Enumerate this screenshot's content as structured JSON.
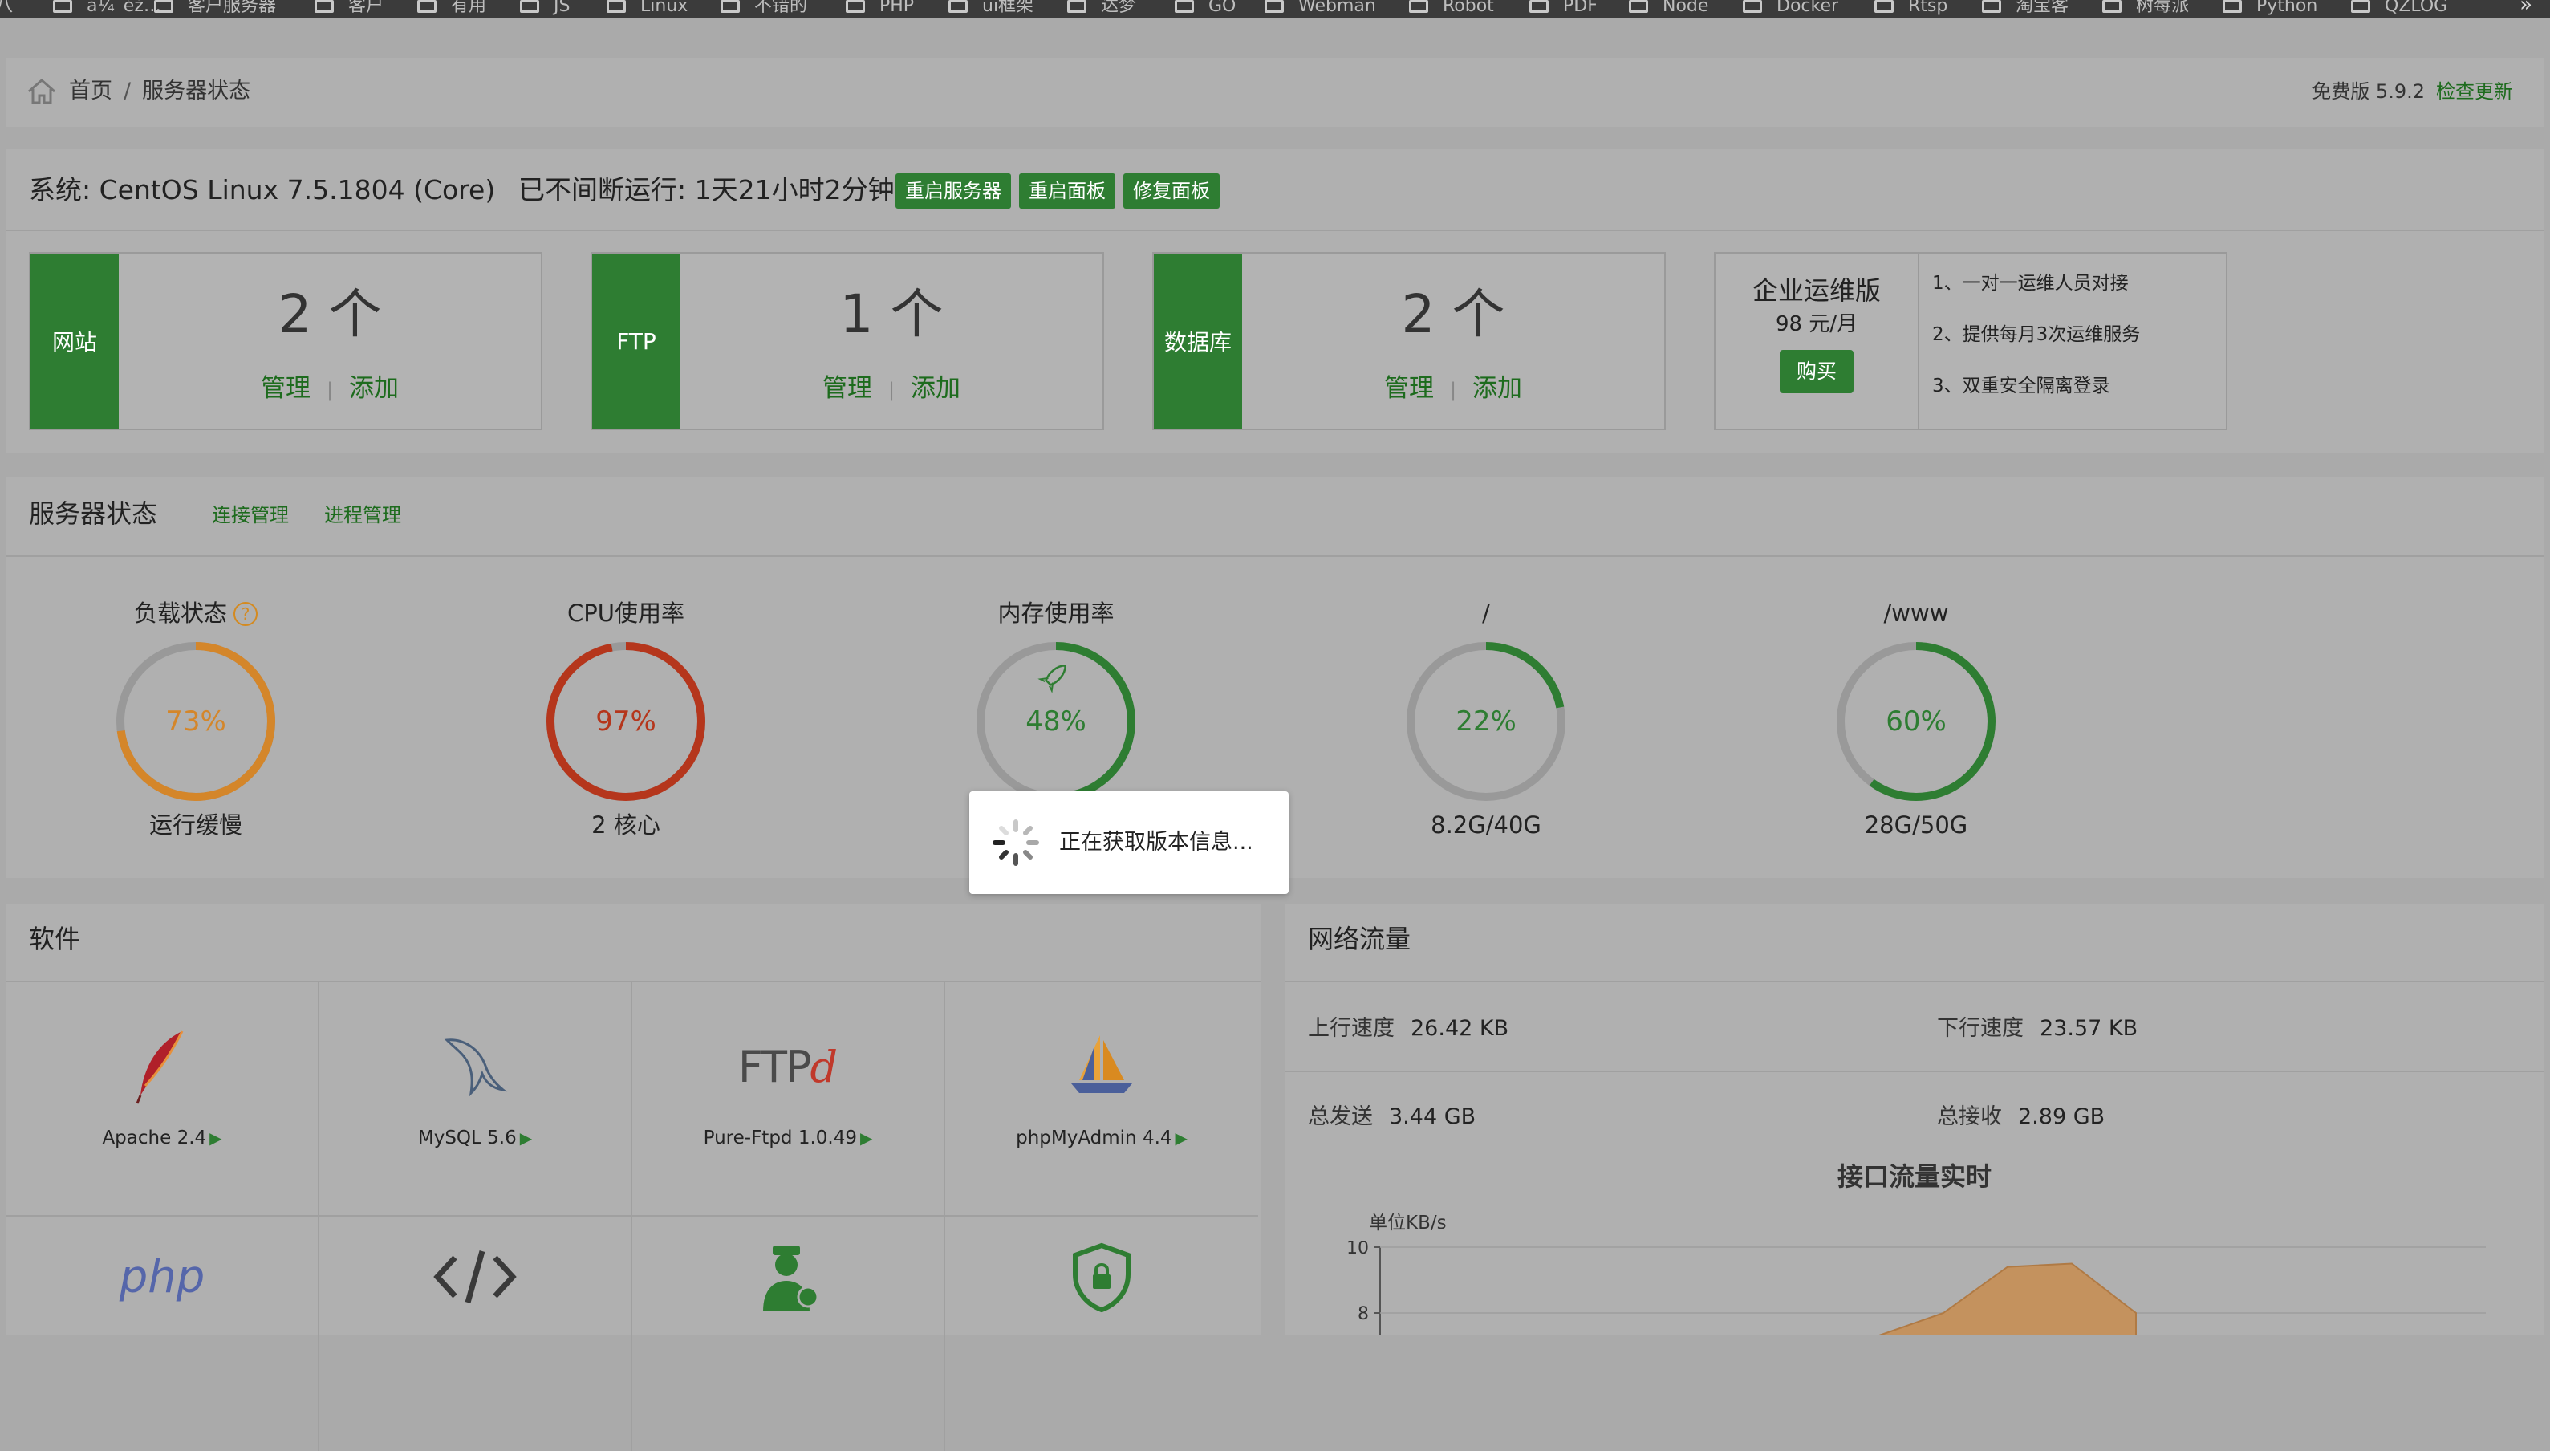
{
  "bookmarks": {
    "items": [
      "ä¼˜éž…",
      "客户服务器",
      "客户",
      "有用",
      "JS",
      "Linux",
      "不错的",
      "PHP",
      "ui框架",
      "达梦",
      "GO",
      "Webman",
      "Robot",
      "PDF",
      "Node",
      "Docker",
      "Rtsp",
      "淘宝客",
      "树莓派",
      "Python",
      "QZLOG"
    ],
    "more": "»"
  },
  "breadcrumb": {
    "home": "首页",
    "separator": "/",
    "current": "服务器状态",
    "version": "免费版 5.9.2",
    "update": "检查更新"
  },
  "system": {
    "name": "系统: CentOS Linux 7.5.1804 (Core)",
    "uptime": "已不间断运行: 1天21小时2分钟",
    "buttons": [
      "重启服务器",
      "重启面板",
      "修复面板"
    ]
  },
  "cards": [
    {
      "tag": "网站",
      "count": "2 个",
      "manage": "管理",
      "add": "添加"
    },
    {
      "tag": "FTP",
      "count": "1 个",
      "manage": "管理",
      "add": "添加"
    },
    {
      "tag": "数据库",
      "count": "2 个",
      "manage": "管理",
      "add": "添加"
    }
  ],
  "enterprise": {
    "name": "企业运维版",
    "price": "98 元/月",
    "buy": "购买",
    "features": [
      "1、一对一运维人员对接",
      "2、提供每月3次运维服务",
      "3、双重安全隔离登录"
    ]
  },
  "status": {
    "title": "服务器状态",
    "links": [
      "连接管理",
      "进程管理"
    ],
    "help": "?",
    "gauges": [
      {
        "title": "负载状态",
        "value": "73%",
        "percent": 73,
        "sub": "运行缓慢",
        "color": "#d4862a"
      },
      {
        "title": "CPU使用率",
        "value": "97%",
        "percent": 97,
        "sub": "2 核心",
        "color": "#b5361c"
      },
      {
        "title": "内存使用率",
        "value": "48%",
        "percent": 48,
        "sub": "",
        "color": "#2e7d32"
      },
      {
        "title": "/",
        "value": "22%",
        "percent": 22,
        "sub": "8.2G/40G",
        "color": "#2e7d32"
      },
      {
        "title": "/www",
        "value": "60%",
        "percent": 60,
        "sub": "28G/50G",
        "color": "#2e7d32"
      }
    ]
  },
  "toast": {
    "text": "正在获取版本信息..."
  },
  "software": {
    "title": "软件",
    "items": [
      {
        "label": "Apache 2.4",
        "icon": "apache-feather-icon"
      },
      {
        "label": "MySQL 5.6",
        "icon": "mysql-dolphin-icon"
      },
      {
        "label": "Pure-Ftpd 1.0.49",
        "icon": "ftpd-logo-icon"
      },
      {
        "label": "phpMyAdmin 4.4",
        "icon": "phpmyadmin-sailboat-icon"
      },
      {
        "label": "",
        "icon": "php-logo-icon"
      },
      {
        "label": "",
        "icon": "code-brackets-icon"
      },
      {
        "label": "",
        "icon": "worker-icon"
      },
      {
        "label": "",
        "icon": "shield-lock-icon"
      }
    ],
    "php_text": "php",
    "ftpd_text": "FTP",
    "ftpd_d": "d",
    "arrow": "▶"
  },
  "network": {
    "title": "网络流量",
    "up_label": "上行速度",
    "up_value": "26.42 KB",
    "down_label": "下行速度",
    "down_value": "23.57 KB",
    "sent_label": "总发送",
    "sent_value": "3.44 GB",
    "recv_label": "总接收",
    "recv_value": "2.89 GB",
    "chart_title": "接口流量实时",
    "unit": "单位KB/s"
  },
  "chart_data": {
    "type": "area",
    "title": "接口流量实时",
    "ylabel": "单位KB/s",
    "yticks": [
      8,
      10
    ],
    "ylim": [
      0,
      10
    ],
    "series": [
      {
        "values": [
          0,
          0,
          0,
          8,
          9.4,
          9.5,
          8
        ]
      }
    ]
  }
}
